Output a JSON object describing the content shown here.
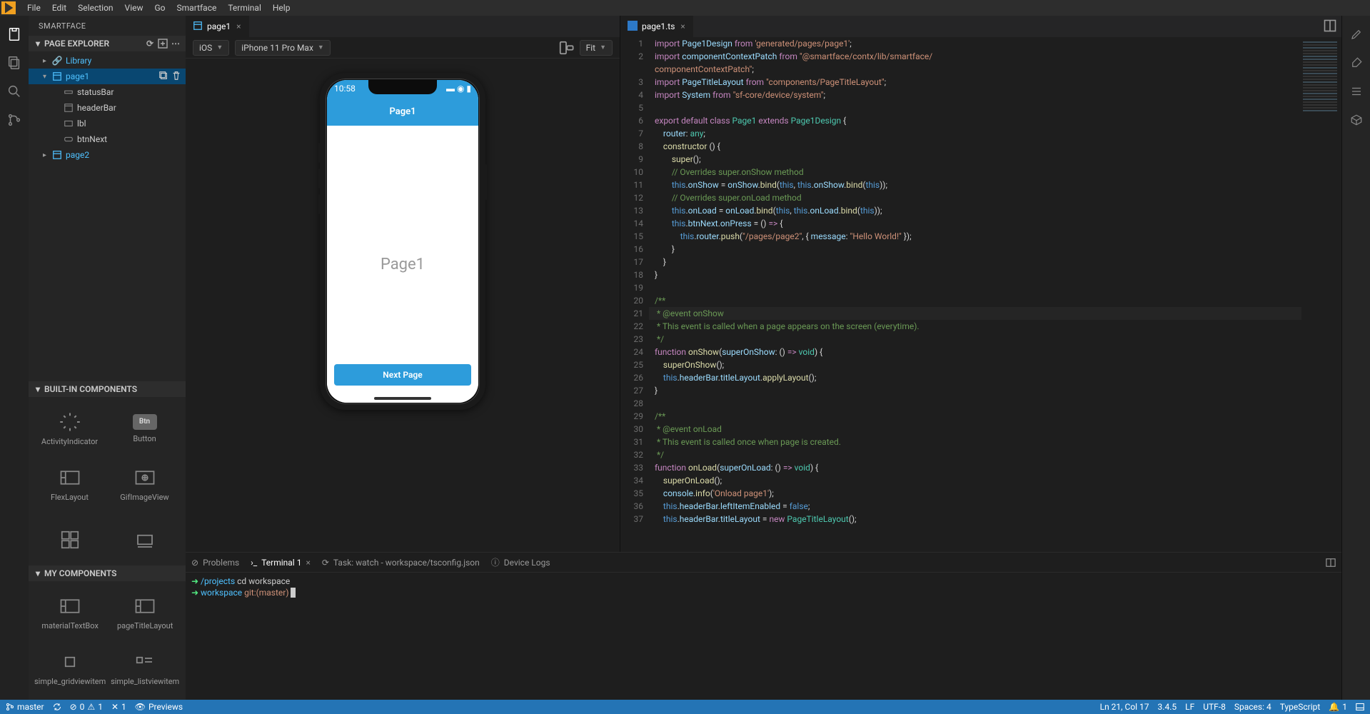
{
  "menubar": [
    "File",
    "Edit",
    "Selection",
    "View",
    "Go",
    "Smartface",
    "Terminal",
    "Help"
  ],
  "sidebar": {
    "title": "SMARTFACE",
    "sections": {
      "pageExplorer": {
        "title": "PAGE EXPLORER"
      },
      "builtIn": {
        "title": "BUILT-IN COMPONENTS"
      },
      "myComponents": {
        "title": "MY COMPONENTS"
      }
    }
  },
  "tree": {
    "library": "Library",
    "page1": "page1",
    "page1_children": [
      "statusBar",
      "headerBar",
      "lbl",
      "btnNext"
    ],
    "page2": "page2"
  },
  "builtIn": [
    "ActivityIndicator",
    "Button",
    "FlexLayout",
    "GifImageView"
  ],
  "myComponents": [
    "materialTextBox",
    "pageTitleLayout",
    "simple_gridviewitem",
    "simple_listviewitem"
  ],
  "designer": {
    "tab": "page1",
    "platform": "iOS",
    "device": "iPhone 11 Pro Max",
    "zoom": "Fit",
    "statusTime": "10:58",
    "headerTitle": "Page1",
    "lblText": "Page1",
    "btnText": "Next Page"
  },
  "codeTab": "page1.ts",
  "code": [
    [
      [
        "k",
        "import "
      ],
      [
        "id",
        "Page1Design"
      ],
      [
        "k",
        " from "
      ],
      [
        "str",
        "'generated/pages/page1'"
      ],
      [
        "p",
        ";"
      ]
    ],
    [
      [
        "k",
        "import "
      ],
      [
        "id",
        "componentContextPatch"
      ],
      [
        "k",
        " from "
      ],
      [
        "str",
        "\"@smartface/contx/lib/smartface/"
      ]
    ],
    [
      [
        "str",
        "componentContextPatch\""
      ],
      [
        "p",
        ";"
      ]
    ],
    [
      [
        "k",
        "import "
      ],
      [
        "id",
        "PageTitleLayout"
      ],
      [
        "k",
        " from "
      ],
      [
        "str",
        "\"components/PageTitleLayout\""
      ],
      [
        "p",
        ";"
      ]
    ],
    [
      [
        "k",
        "import "
      ],
      [
        "id",
        "System"
      ],
      [
        "k",
        " from "
      ],
      [
        "str",
        "\"sf-core/device/system\""
      ],
      [
        "p",
        ";"
      ]
    ],
    [],
    [
      [
        "k",
        "export default class "
      ],
      [
        "cls",
        "Page1"
      ],
      [
        "k",
        " extends "
      ],
      [
        "cls",
        "Page1Design"
      ],
      [
        "p",
        " {"
      ]
    ],
    [
      [
        "p",
        "    "
      ],
      [
        "id",
        "router"
      ],
      [
        "p",
        ": "
      ],
      [
        "cls",
        "any"
      ],
      [
        "p",
        ";"
      ]
    ],
    [
      [
        "p",
        "    "
      ],
      [
        "fn",
        "constructor"
      ],
      [
        "p",
        " () {"
      ]
    ],
    [
      [
        "p",
        "        "
      ],
      [
        "fn",
        "super"
      ],
      [
        "p",
        "();"
      ]
    ],
    [
      [
        "p",
        "        "
      ],
      [
        "cmt",
        "// Overrides super.onShow method"
      ]
    ],
    [
      [
        "p",
        "        "
      ],
      [
        "this",
        "this"
      ],
      [
        "p",
        "."
      ],
      [
        "id",
        "onShow"
      ],
      [
        "p",
        " = "
      ],
      [
        "id",
        "onShow"
      ],
      [
        "p",
        "."
      ],
      [
        "fn",
        "bind"
      ],
      [
        "p",
        "("
      ],
      [
        "this",
        "this"
      ],
      [
        "p",
        ", "
      ],
      [
        "this",
        "this"
      ],
      [
        "p",
        "."
      ],
      [
        "id",
        "onShow"
      ],
      [
        "p",
        "."
      ],
      [
        "fn",
        "bind"
      ],
      [
        "p",
        "("
      ],
      [
        "this",
        "this"
      ],
      [
        "p",
        "));"
      ]
    ],
    [
      [
        "p",
        "        "
      ],
      [
        "cmt",
        "// Overrides super.onLoad method"
      ]
    ],
    [
      [
        "p",
        "        "
      ],
      [
        "this",
        "this"
      ],
      [
        "p",
        "."
      ],
      [
        "id",
        "onLoad"
      ],
      [
        "p",
        " = "
      ],
      [
        "id",
        "onLoad"
      ],
      [
        "p",
        "."
      ],
      [
        "fn",
        "bind"
      ],
      [
        "p",
        "("
      ],
      [
        "this",
        "this"
      ],
      [
        "p",
        ", "
      ],
      [
        "this",
        "this"
      ],
      [
        "p",
        "."
      ],
      [
        "id",
        "onLoad"
      ],
      [
        "p",
        "."
      ],
      [
        "fn",
        "bind"
      ],
      [
        "p",
        "("
      ],
      [
        "this",
        "this"
      ],
      [
        "p",
        "));"
      ]
    ],
    [
      [
        "p",
        "        "
      ],
      [
        "this",
        "this"
      ],
      [
        "p",
        "."
      ],
      [
        "id",
        "btnNext"
      ],
      [
        "p",
        "."
      ],
      [
        "id",
        "onPress"
      ],
      [
        "p",
        " = () "
      ],
      [
        "k",
        "=>"
      ],
      [
        "p",
        " {"
      ]
    ],
    [
      [
        "p",
        "            "
      ],
      [
        "this",
        "this"
      ],
      [
        "p",
        "."
      ],
      [
        "id",
        "router"
      ],
      [
        "p",
        "."
      ],
      [
        "fn",
        "push"
      ],
      [
        "p",
        "("
      ],
      [
        "str",
        "\"/pages/page2\""
      ],
      [
        "p",
        ", { "
      ],
      [
        "id",
        "message"
      ],
      [
        "p",
        ": "
      ],
      [
        "str",
        "\"Hello World!\""
      ],
      [
        "p",
        " });"
      ]
    ],
    [
      [
        "p",
        "        }"
      ]
    ],
    [
      [
        "p",
        "    }"
      ]
    ],
    [
      [
        "p",
        "}"
      ]
    ],
    [],
    [
      [
        "cmt",
        "/**"
      ]
    ],
    [
      [
        "cmt",
        " * @event onShow"
      ]
    ],
    [
      [
        "cmt",
        " * This event is called when a page appears on the screen (everytime)."
      ]
    ],
    [
      [
        "cmt",
        " */"
      ]
    ],
    [
      [
        "k",
        "function "
      ],
      [
        "fn",
        "onShow"
      ],
      [
        "p",
        "("
      ],
      [
        "id",
        "superOnShow"
      ],
      [
        "p",
        ": () "
      ],
      [
        "k",
        "=>"
      ],
      [
        "p",
        " "
      ],
      [
        "cls",
        "void"
      ],
      [
        "p",
        ") {"
      ]
    ],
    [
      [
        "p",
        "    "
      ],
      [
        "fn",
        "superOnShow"
      ],
      [
        "p",
        "();"
      ]
    ],
    [
      [
        "p",
        "    "
      ],
      [
        "this",
        "this"
      ],
      [
        "p",
        "."
      ],
      [
        "id",
        "headerBar"
      ],
      [
        "p",
        "."
      ],
      [
        "id",
        "titleLayout"
      ],
      [
        "p",
        "."
      ],
      [
        "fn",
        "applyLayout"
      ],
      [
        "p",
        "();"
      ]
    ],
    [
      [
        "p",
        "}"
      ]
    ],
    [],
    [
      [
        "cmt",
        "/**"
      ]
    ],
    [
      [
        "cmt",
        " * @event onLoad"
      ]
    ],
    [
      [
        "cmt",
        " * This event is called once when page is created."
      ]
    ],
    [
      [
        "cmt",
        " */"
      ]
    ],
    [
      [
        "k",
        "function "
      ],
      [
        "fn",
        "onLoad"
      ],
      [
        "p",
        "("
      ],
      [
        "id",
        "superOnLoad"
      ],
      [
        "p",
        ": () "
      ],
      [
        "k",
        "=>"
      ],
      [
        "p",
        " "
      ],
      [
        "cls",
        "void"
      ],
      [
        "p",
        ") {"
      ]
    ],
    [
      [
        "p",
        "    "
      ],
      [
        "fn",
        "superOnLoad"
      ],
      [
        "p",
        "();"
      ]
    ],
    [
      [
        "p",
        "    "
      ],
      [
        "id",
        "console"
      ],
      [
        "p",
        "."
      ],
      [
        "fn",
        "info"
      ],
      [
        "p",
        "("
      ],
      [
        "str",
        "'Onload page1'"
      ],
      [
        "p",
        ");"
      ]
    ],
    [
      [
        "p",
        "    "
      ],
      [
        "this",
        "this"
      ],
      [
        "p",
        "."
      ],
      [
        "id",
        "headerBar"
      ],
      [
        "p",
        "."
      ],
      [
        "id",
        "leftItemEnabled"
      ],
      [
        "p",
        " = "
      ],
      [
        "this",
        "false"
      ],
      [
        "p",
        ";"
      ]
    ],
    [
      [
        "p",
        "    "
      ],
      [
        "this",
        "this"
      ],
      [
        "p",
        "."
      ],
      [
        "id",
        "headerBar"
      ],
      [
        "p",
        "."
      ],
      [
        "id",
        "titleLayout"
      ],
      [
        "p",
        " = "
      ],
      [
        "k",
        "new "
      ],
      [
        "cls",
        "PageTitleLayout"
      ],
      [
        "p",
        "();"
      ]
    ]
  ],
  "lineNumbers": [
    "1",
    "2",
    "",
    "3",
    "4",
    "5",
    "6",
    "7",
    "8",
    "9",
    "10",
    "11",
    "12",
    "13",
    "14",
    "15",
    "16",
    "17",
    "18",
    "19",
    "20",
    "21",
    "22",
    "23",
    "24",
    "25",
    "26",
    "27",
    "28",
    "29",
    "30",
    "31",
    "32",
    "33",
    "34",
    "35",
    "36",
    "37"
  ],
  "bpanel": {
    "problems": "Problems",
    "terminal": "Terminal 1",
    "task": "Task: watch - workspace/tsconfig.json",
    "devicelogs": "Device Logs"
  },
  "terminal": {
    "line1_path": "/projects",
    "line1_cmd": " cd workspace",
    "line2_path": "workspace",
    "line2_git": " git:(",
    "line2_branch": "master",
    "line2_close": ")"
  },
  "status": {
    "branch": "master",
    "errors": "0",
    "warnings": "1",
    "misc": "1",
    "previews": "Previews",
    "ln": "Ln 21, Col 17",
    "version": "3.4.5",
    "eol": "LF",
    "encoding": "UTF-8",
    "spaces": "Spaces: 4",
    "lang": "TypeScript",
    "bell": "1"
  }
}
